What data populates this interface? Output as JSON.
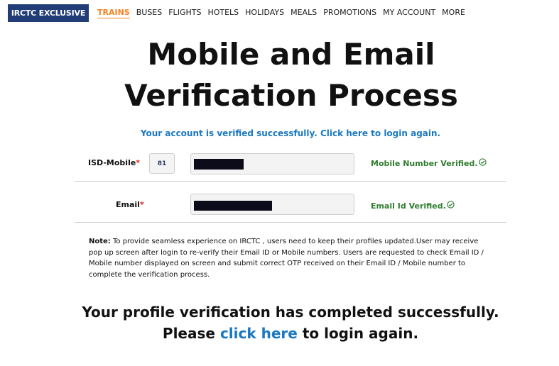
{
  "header": {
    "badge": "IRCTC EXCLUSIVE",
    "nav": [
      "TRAINS",
      "BUSES",
      "FLIGHTS",
      "HOTELS",
      "HOLIDAYS",
      "MEALS",
      "PROMOTIONS",
      "MY ACCOUNT",
      "MORE"
    ],
    "active_nav": "TRAINS"
  },
  "page": {
    "title_line1": "Mobile and Email",
    "title_line2": "Verification Process",
    "success_message": "Your account is verified successfully. Click here to login again."
  },
  "form": {
    "mobile_label": "ISD-Mobile",
    "isd_code": "81",
    "mobile_status": "Mobile Number Verified.",
    "email_label": "Email",
    "email_status": "Email Id Verified.",
    "required_mark": "*"
  },
  "note": {
    "prefix": "Note:",
    "text": " To provide seamless experience on IRCTC , users need to keep their profiles updated.User may receive pop up screen after login to re-verify their Email ID or Mobile numbers. Users are requested to check Email ID / Mobile number displayed on screen and submit correct OTP received on their Email ID / Mobile number to complete the verification process."
  },
  "completion": {
    "line1": "Your profile verification has completed successfully.",
    "line2_pre": "Please ",
    "link": "click here",
    "line2_post": " to login again."
  },
  "colors": {
    "brand_navy": "#213d77",
    "active_orange": "#f58220",
    "link_blue": "#1a78c2",
    "verified_green": "#2f7d2f"
  },
  "icons": [
    "check-circle-icon"
  ]
}
